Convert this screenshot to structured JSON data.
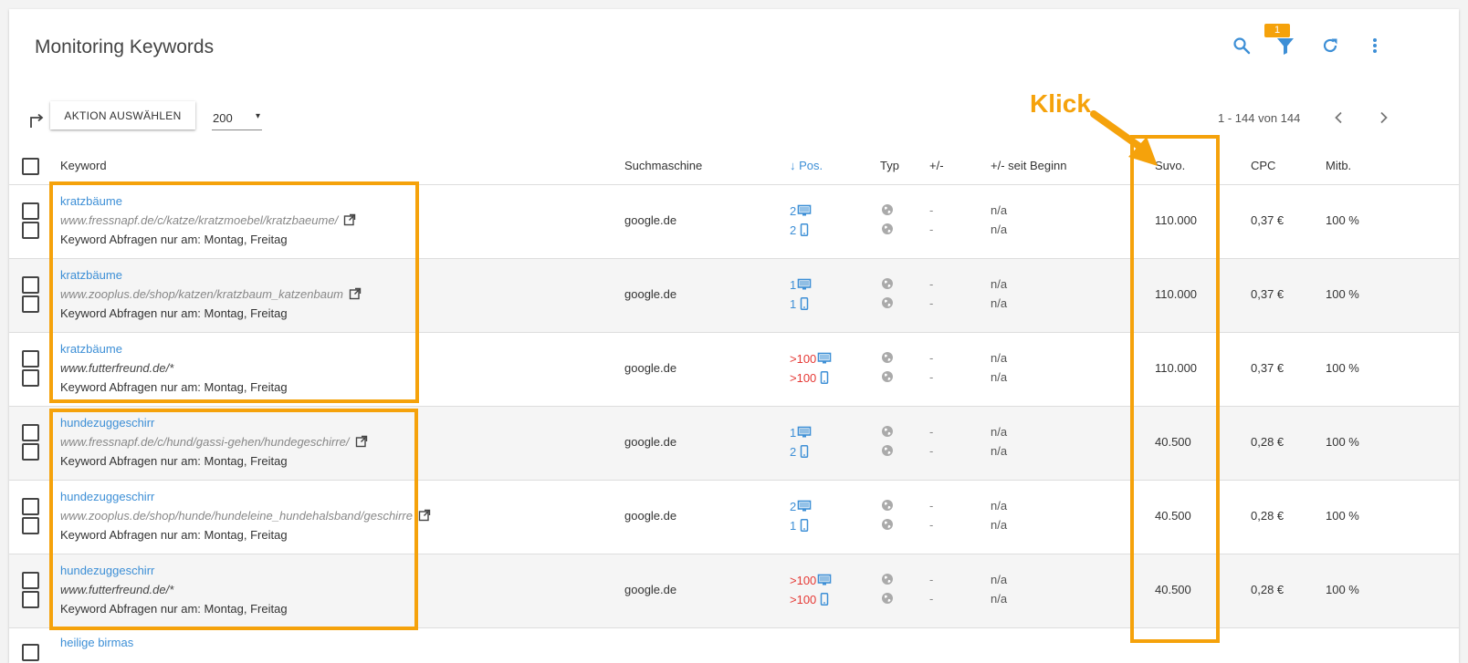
{
  "header": {
    "title": "Monitoring Keywords",
    "filter_badge": "1"
  },
  "toolbar": {
    "action_label": "AKTION AUSWÄHLEN",
    "page_size": "200",
    "page_size_arrow": "▾",
    "pagination_text": "1 - 144 von 144"
  },
  "columns": {
    "keyword": "Keyword",
    "engine": "Suchmaschine",
    "position": "Pos.",
    "position_sort_arrow": "↓",
    "type": "Typ",
    "change": "+/-",
    "change_since_start": "+/- seit Beginn",
    "search_volume": "Suvo.",
    "cpc": "CPC",
    "competition": "Mitb."
  },
  "rows": [
    {
      "keyword": "kratzbäume",
      "url": "www.fressnapf.de/c/katze/kratzmoebel/kratzbaeume/",
      "note": "Keyword Abfragen nur am: Montag, Freitag",
      "engine": "google.de",
      "pos_desktop": "2",
      "pos_mobile": "2",
      "change_1": "-",
      "change_2": "-",
      "since_1": "n/a",
      "since_2": "n/a",
      "volume": "110.000",
      "cpc": "0,37 €",
      "competition": "100 %"
    },
    {
      "keyword": "kratzbäume",
      "url": "www.zooplus.de/shop/katzen/kratzbaum_katzenbaum",
      "note": "Keyword Abfragen nur am: Montag, Freitag",
      "engine": "google.de",
      "pos_desktop": "1",
      "pos_mobile": "1",
      "change_1": "-",
      "change_2": "-",
      "since_1": "n/a",
      "since_2": "n/a",
      "volume": "110.000",
      "cpc": "0,37 €",
      "competition": "100 %"
    },
    {
      "keyword": "kratzbäume",
      "url": "www.futterfreund.de/*",
      "note": "Keyword Abfragen nur am: Montag, Freitag",
      "engine": "google.de",
      "pos_desktop": ">100",
      "pos_mobile": ">100",
      "change_1": "-",
      "change_2": "-",
      "since_1": "n/a",
      "since_2": "n/a",
      "volume": "110.000",
      "cpc": "0,37 €",
      "competition": "100 %"
    },
    {
      "keyword": "hundezuggeschirr",
      "url": "www.fressnapf.de/c/hund/gassi-gehen/hundegeschirre/",
      "note": "Keyword Abfragen nur am: Montag, Freitag",
      "engine": "google.de",
      "pos_desktop": "1",
      "pos_mobile": "2",
      "change_1": "-",
      "change_2": "-",
      "since_1": "n/a",
      "since_2": "n/a",
      "volume": "40.500",
      "cpc": "0,28 €",
      "competition": "100 %"
    },
    {
      "keyword": "hundezuggeschirr",
      "url": "www.zooplus.de/shop/hunde/hundeleine_hundehalsband/geschirre",
      "note": "Keyword Abfragen nur am: Montag, Freitag",
      "engine": "google.de",
      "pos_desktop": "2",
      "pos_mobile": "1",
      "change_1": "-",
      "change_2": "-",
      "since_1": "n/a",
      "since_2": "n/a",
      "volume": "40.500",
      "cpc": "0,28 €",
      "competition": "100 %"
    },
    {
      "keyword": "hundezuggeschirr",
      "url": "www.futterfreund.de/*",
      "note": "Keyword Abfragen nur am: Montag, Freitag",
      "engine": "google.de",
      "pos_desktop": ">100",
      "pos_mobile": ">100",
      "change_1": "-",
      "change_2": "-",
      "since_1": "n/a",
      "since_2": "n/a",
      "volume": "40.500",
      "cpc": "0,28 €",
      "competition": "100 %"
    }
  ],
  "partial_row": {
    "keyword": "heilige birmas"
  },
  "annotation": {
    "label": "Klick",
    "color": "#f5a20b"
  },
  "colors": {
    "accent": "#3d8fd6",
    "danger": "#e53935",
    "annotation": "#f5a20b"
  }
}
